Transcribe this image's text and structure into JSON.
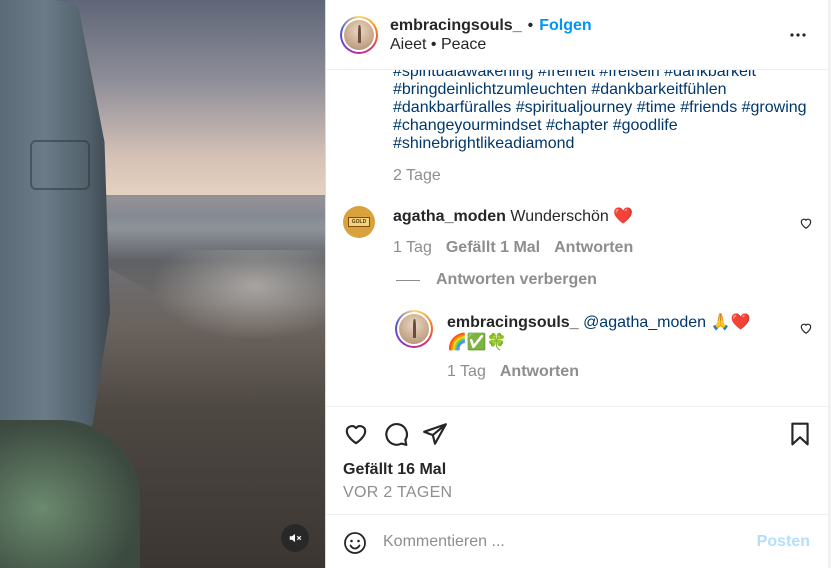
{
  "post": {
    "username": "embracingsouls_",
    "separator": "•",
    "follow_label": "Folgen",
    "location": "Aieet • Peace"
  },
  "caption": {
    "hashtags": "#spiritualawakening #freiheit #freisein #dankbarkeit #bringdeinlichtzumleuchten #dankbarkeitfühlen #dankbarfüralles #spiritualjourney #time #friends #growing #changeyourmindset #chapter #goodlife #shinebrightlikeadiamond",
    "time": "2 Tage"
  },
  "comments": [
    {
      "username": "agatha_moden",
      "text": "Wunderschön ❤️",
      "time": "1 Tag",
      "likes": "Gefällt 1 Mal",
      "reply_label": "Antworten",
      "hide_replies": "Antworten verbergen",
      "replies": [
        {
          "username": "embracingsouls_",
          "mention": "@agatha_moden",
          "text_line1": "🙏❤️",
          "text_line2": "🌈✅🍀",
          "time": "1 Tag",
          "reply_label": "Antworten"
        }
      ]
    }
  ],
  "actions": {
    "likes": "Gefällt 16 Mal",
    "ago": "VOR 2 TAGEN"
  },
  "composer": {
    "placeholder": "Kommentieren ...",
    "post_label": "Posten"
  },
  "icons": [
    "mute-icon",
    "more-icon",
    "heart-icon",
    "comment-icon",
    "share-icon",
    "bookmark-icon",
    "emoji-icon"
  ],
  "colors": {
    "accent": "#0095f6",
    "link": "#00376b",
    "muted": "#8e8e8e",
    "post_disabled": "#b2dffc"
  }
}
